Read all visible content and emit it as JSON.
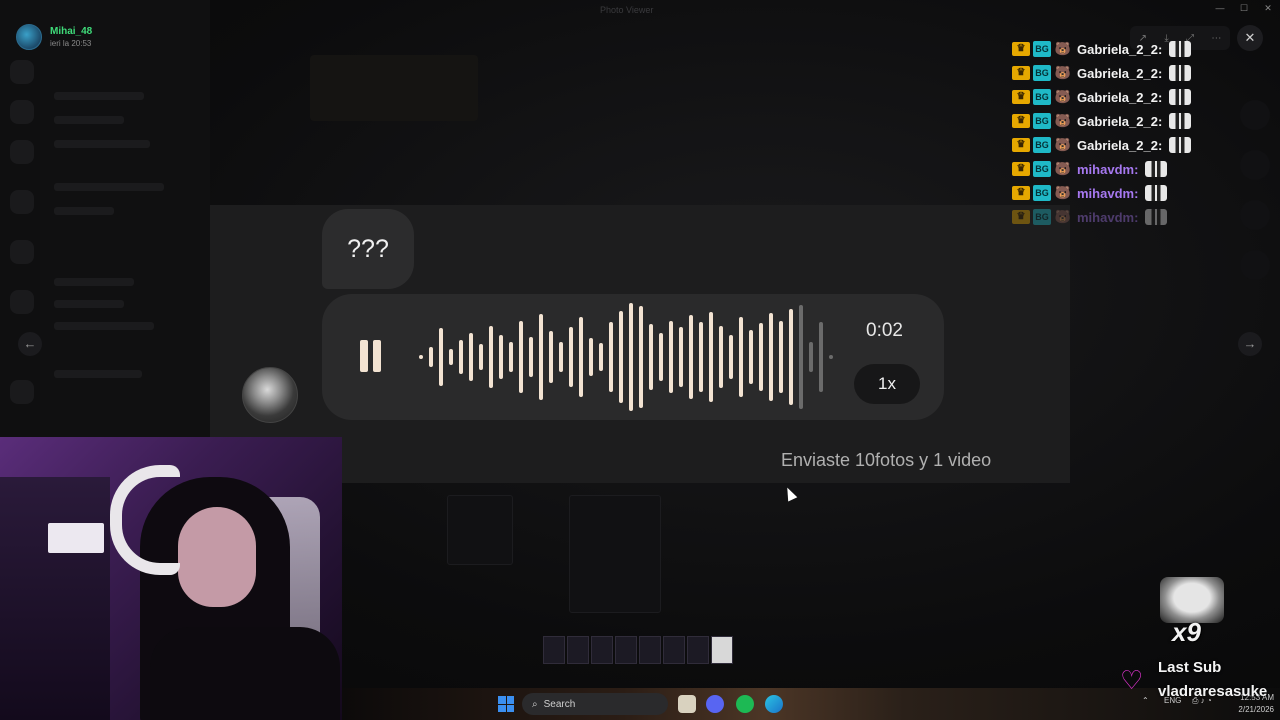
{
  "window": {
    "title": "Photo Viewer",
    "controls": [
      "—",
      "☐",
      "✕"
    ]
  },
  "uploader": {
    "name": "Mihai_48",
    "time": "ieri la 20:53",
    "avatar_icon": "avatar-icon"
  },
  "viewer_tools": {
    "icons": [
      "share-icon",
      "download-icon",
      "expand-icon",
      "more-icon"
    ],
    "glyphs": [
      "↗",
      "⤓",
      "⤢",
      "⋯"
    ],
    "close_glyph": "✕"
  },
  "nav": {
    "prev_glyph": "←",
    "next_glyph": "→"
  },
  "media": {
    "text_bubble": "???",
    "voice_message": {
      "state": "playing",
      "time": "0:02",
      "speed": "1x",
      "progress": 0.9
    },
    "caption": "Enviaste 10fotos y 1 video"
  },
  "chat": {
    "messages": [
      {
        "user": "Gabriela_2_2:",
        "color": "#f2f2f2"
      },
      {
        "user": "Gabriela_2_2:",
        "color": "#f2f2f2"
      },
      {
        "user": "Gabriela_2_2:",
        "color": "#f2f2f2"
      },
      {
        "user": "Gabriela_2_2:",
        "color": "#f2f2f2"
      },
      {
        "user": "Gabriela_2_2:",
        "color": "#f2f2f2"
      },
      {
        "user": "mihavdm:",
        "color": "#a678f0"
      },
      {
        "user": "mihavdm:",
        "color": "#a678f0"
      },
      {
        "user": "mihavdm:",
        "color": "#a678f0"
      }
    ],
    "badges": {
      "crown_glyph": "♛",
      "sub_glyph": "BG",
      "emoji": "🐻"
    }
  },
  "last_sub": {
    "multiplier": "x9",
    "label": "Last Sub",
    "user": "vladraresasuke",
    "heart_glyph": "♡"
  },
  "taskbar": {
    "search_placeholder": "Search",
    "search_glyph": "⌕",
    "lang": "ENG",
    "clock_time": "12:53 AM",
    "clock_date": "2/21/2026",
    "tray_glyphs": "⌃",
    "status_glyphs": "⎙ ♪ ◔"
  },
  "colors": {
    "accent_green": "#3fdc7a",
    "waveform": "#f3e3d2",
    "mod_purple": "#a678f0",
    "heart": "#e034d0"
  }
}
